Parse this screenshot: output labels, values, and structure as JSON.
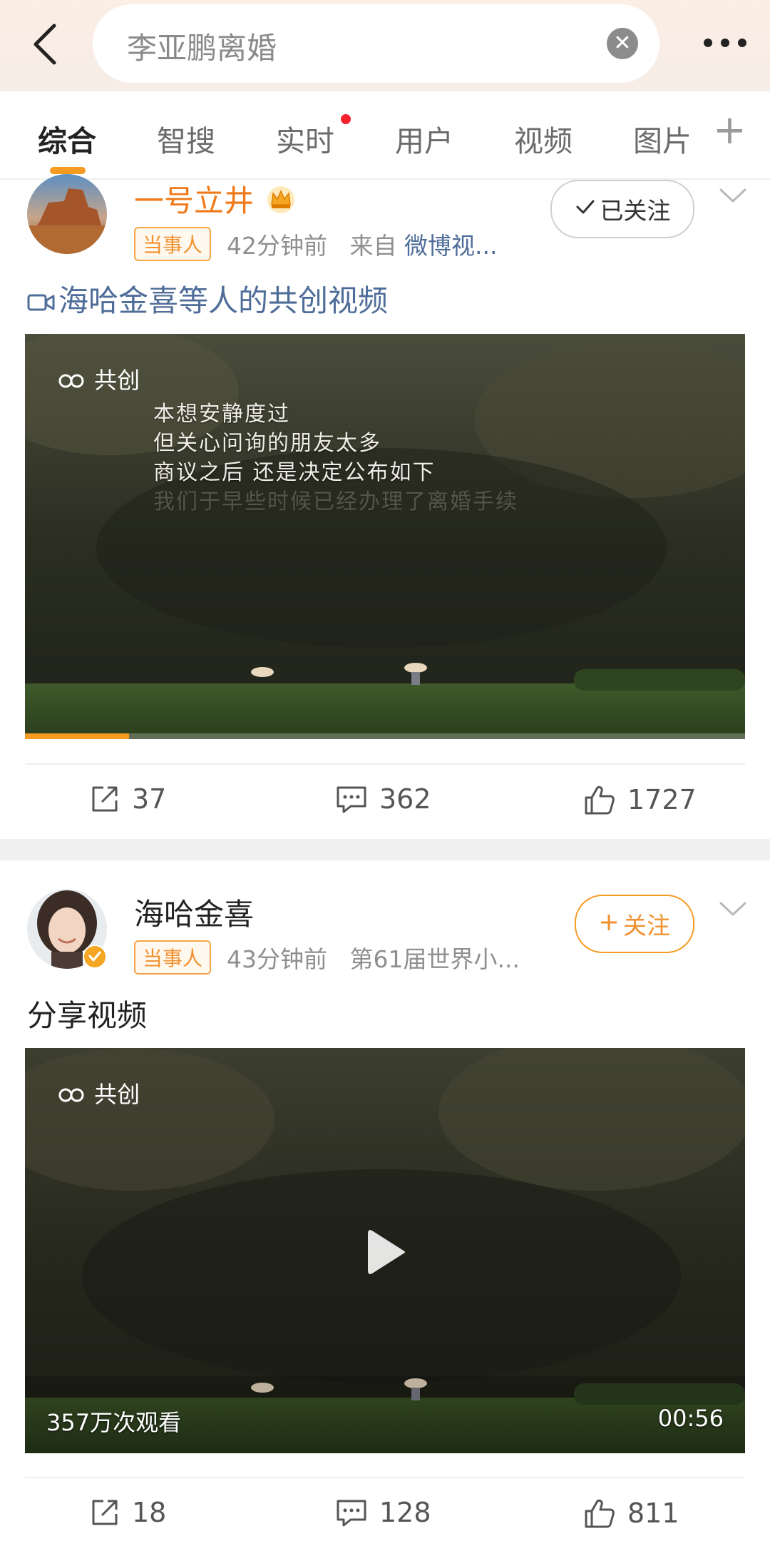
{
  "search": {
    "query": "李亚鹏离婚"
  },
  "tabs": {
    "items": [
      {
        "label": "综合"
      },
      {
        "label": "智搜"
      },
      {
        "label": "实时"
      },
      {
        "label": "用户"
      },
      {
        "label": "视频"
      },
      {
        "label": "图片"
      }
    ],
    "active_index": 0,
    "plus_label": "+"
  },
  "posts": [
    {
      "username": "一号立井",
      "username_color": "#f07a1a",
      "tag": "当事人",
      "time": "42分钟前",
      "source_prefix": "来自",
      "source": "微博视...",
      "follow_label": "已关注",
      "text": "海哈金喜等人的共创视频",
      "video": {
        "badge": "共创",
        "subtitles": [
          "本想安静度过",
          "但关心问询的朋友太多",
          "商议之后 还是决定公布如下",
          "我们于早些时候已经办理了离婚手续"
        ],
        "progress": 0.145
      },
      "actions": {
        "reposts": "37",
        "comments": "362",
        "likes": "1727"
      }
    },
    {
      "username": "海哈金喜",
      "username_color": "#222222",
      "tag": "当事人",
      "time": "43分钟前",
      "source": "第61届世界小...",
      "follow_label": "关注",
      "text": "分享视频",
      "video": {
        "badge": "共创",
        "views": "357万次观看",
        "duration": "00:56"
      },
      "actions": {
        "reposts": "18",
        "comments": "128",
        "likes": "811"
      }
    }
  ],
  "colors": {
    "accent": "#f59b1f",
    "red_dot": "#f5222d",
    "link": "#4f6d99"
  }
}
